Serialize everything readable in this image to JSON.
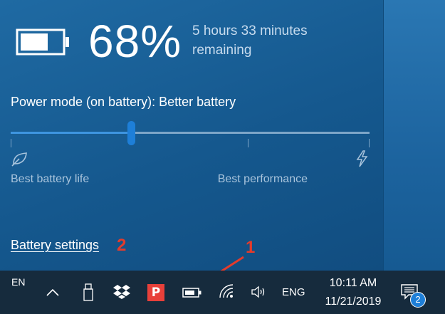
{
  "battery": {
    "percent": "68%",
    "remaining": "5 hours 33 minutes remaining",
    "level": 0.68
  },
  "power_mode": {
    "title": "Power mode (on battery): Better battery",
    "left_label": "Best battery life",
    "right_label": "Best performance",
    "positions": 4,
    "selected_index": 1
  },
  "settings_link": "Battery settings",
  "annotations": {
    "a1": "1",
    "a2": "2",
    "color": "#e53b2b"
  },
  "taskbar": {
    "lang_short": "EN",
    "lang_long": "ENG",
    "time": "10:11 AM",
    "date": "11/21/2019",
    "notification_count": "2",
    "icons": [
      "chevron-up-icon",
      "usb-drive-icon",
      "dropbox-icon",
      "app-p-icon",
      "battery-icon",
      "wifi-icon",
      "volume-icon",
      "action-center-icon"
    ]
  },
  "colors": {
    "accent": "#1e7fd8",
    "flyout": "#15588e",
    "taskbar": "#162b3d",
    "app_red": "#e8403a"
  }
}
